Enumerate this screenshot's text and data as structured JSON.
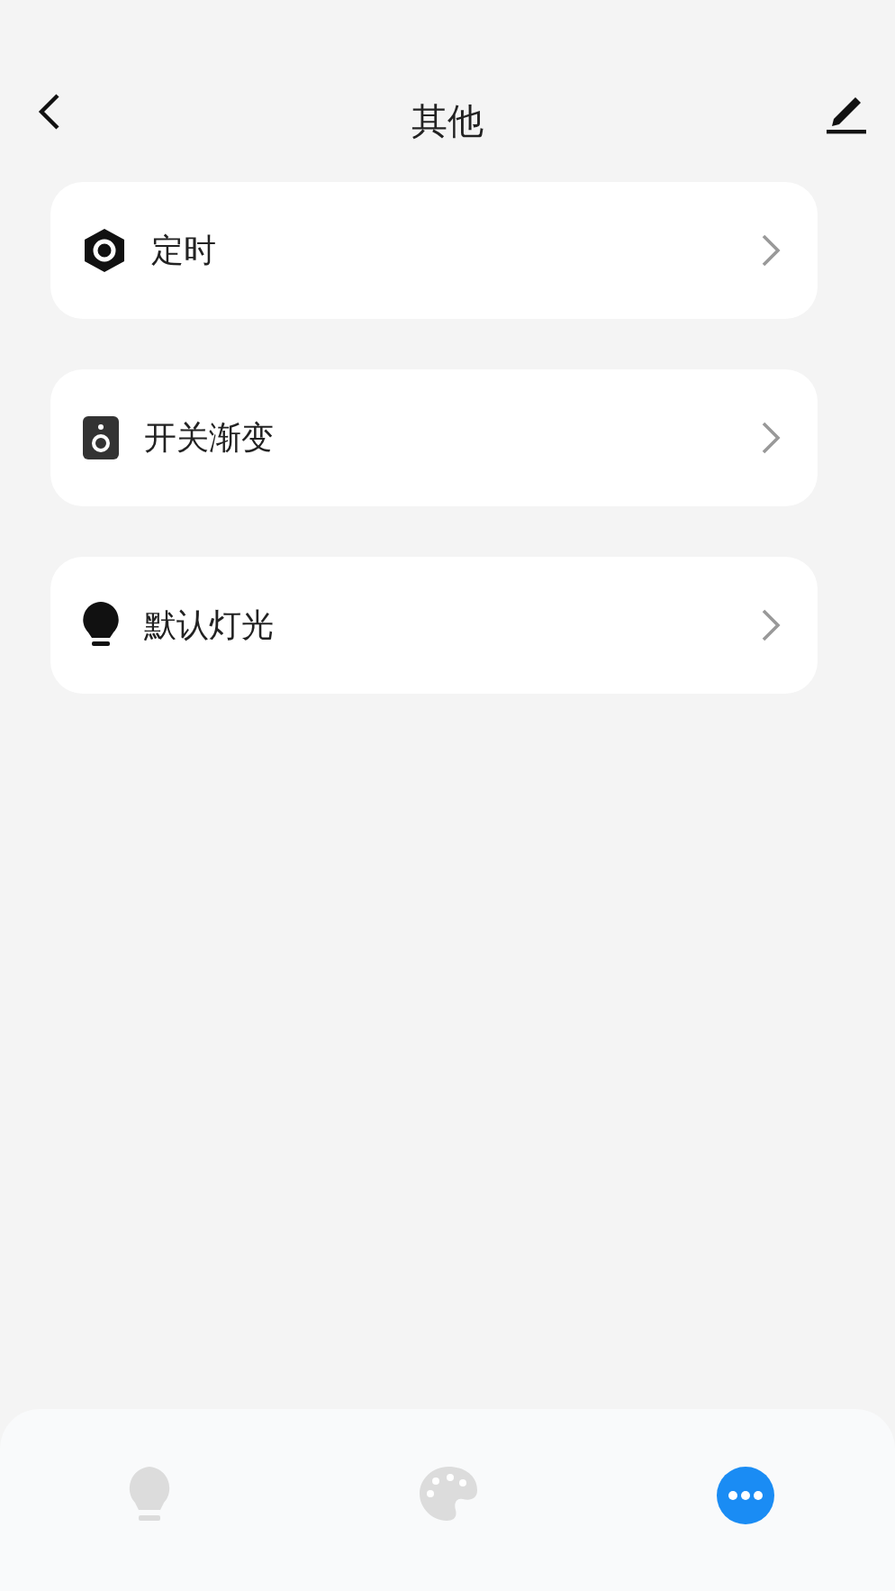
{
  "header": {
    "title": "其他"
  },
  "items": [
    {
      "kind": "timer",
      "label": "定时"
    },
    {
      "kind": "speaker",
      "label": "开关渐变"
    },
    {
      "kind": "bulb",
      "label": "默认灯光"
    }
  ],
  "tabs": [
    {
      "kind": "bulb",
      "selected": false
    },
    {
      "kind": "palette",
      "selected": false
    },
    {
      "kind": "more",
      "selected": true
    }
  ]
}
